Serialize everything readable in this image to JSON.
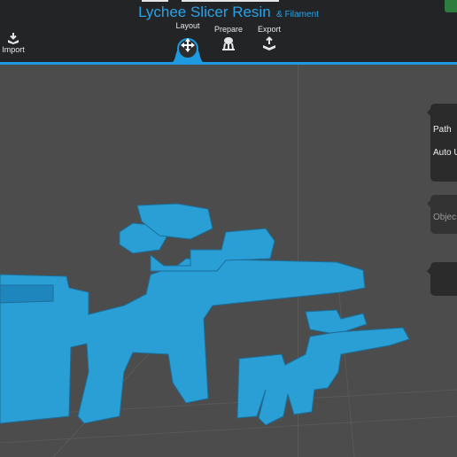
{
  "app": {
    "title_main": "Lychee Slicer Resin",
    "title_sub": "& Filament"
  },
  "toolbar": {
    "import_label": "Import",
    "layout_label": "Layout",
    "prepare_label": "Prepare",
    "export_label": "Export"
  },
  "side_panels": {
    "path_label": "Path",
    "auto_label": "Auto U",
    "object_label": "Objec"
  },
  "colors": {
    "accent": "#1e9be0",
    "model": "#2a9fd6",
    "background": "#4c4c4c",
    "topbar": "#222426"
  }
}
